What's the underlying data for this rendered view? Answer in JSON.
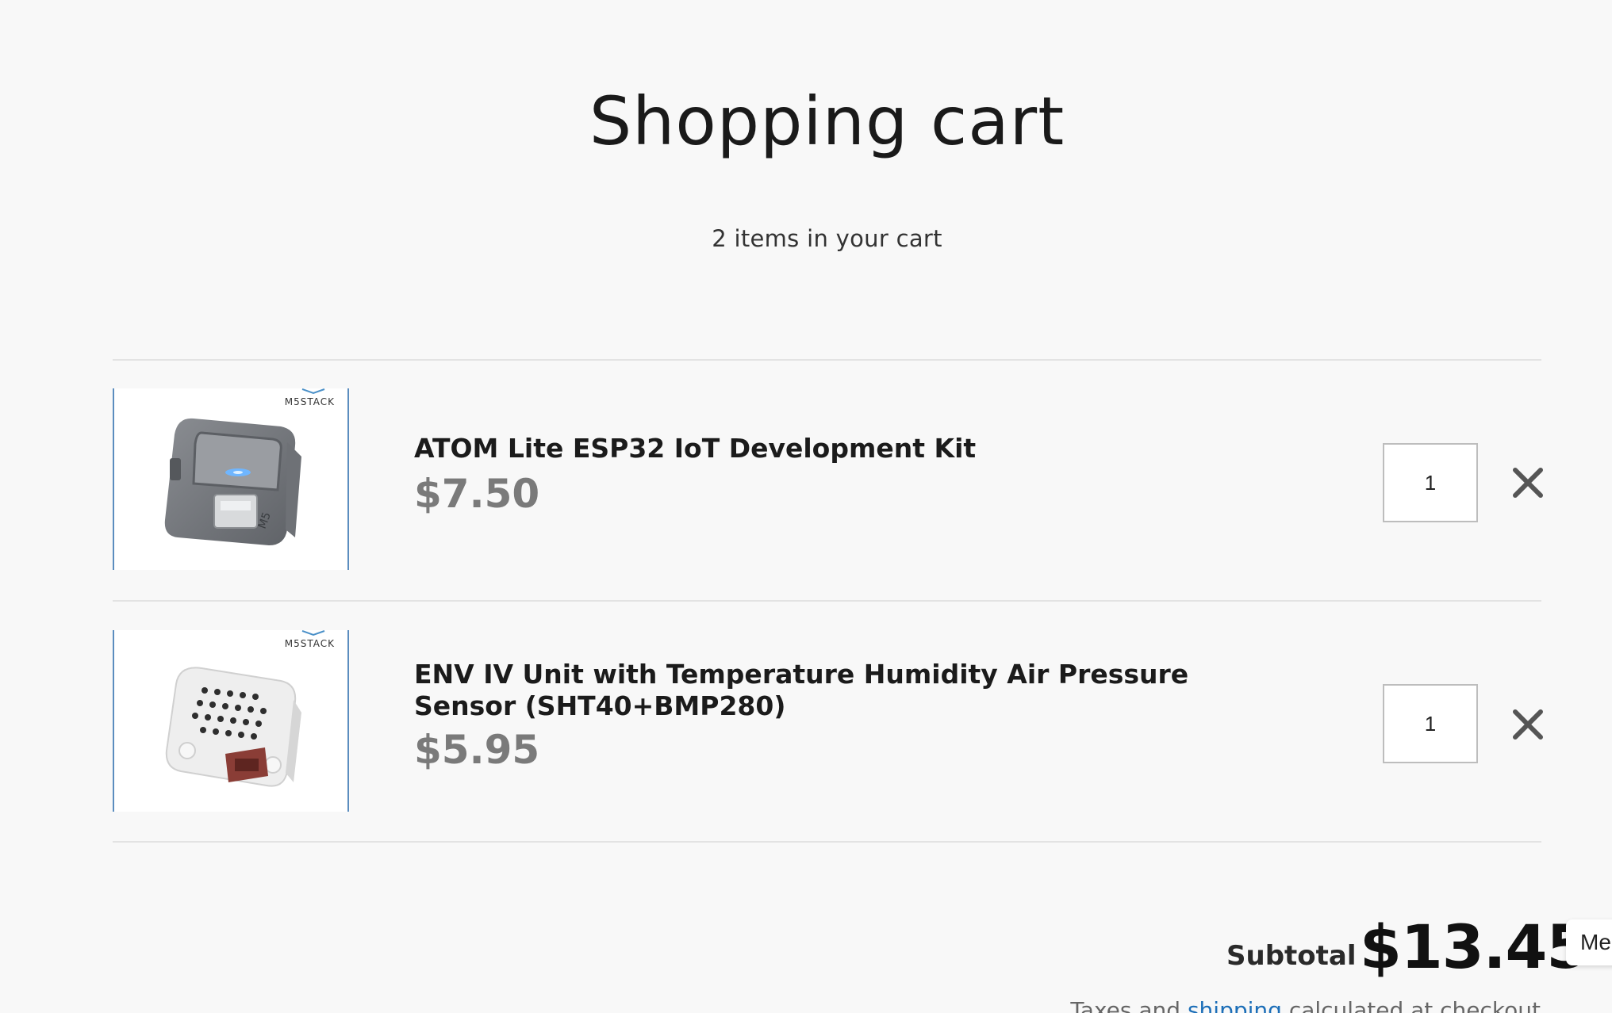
{
  "page": {
    "title": "Shopping cart",
    "item_count_text": "2 items in your cart"
  },
  "cart": {
    "items": [
      {
        "title": "ATOM Lite ESP32 IoT Development Kit",
        "price": "$7.50",
        "quantity": "1",
        "brand": "M5STACK"
      },
      {
        "title": "ENV IV Unit with Temperature Humidity Air Pressure Sensor (SHT40+BMP280)",
        "price": "$5.95",
        "quantity": "1",
        "brand": "M5STACK"
      }
    ]
  },
  "summary": {
    "subtotal_label": "Subtotal",
    "subtotal_value": "$13.45",
    "tax_prefix": "Taxes and",
    "tax_link": "shipping",
    "tax_suffix": "calculated at checkout"
  },
  "side_tab": {
    "label": "Me"
  },
  "colors": {
    "background": "#f8f8f8",
    "price": "#7a7a7a",
    "link": "#1d6fb8",
    "thumb_border": "#5b8dbf"
  }
}
